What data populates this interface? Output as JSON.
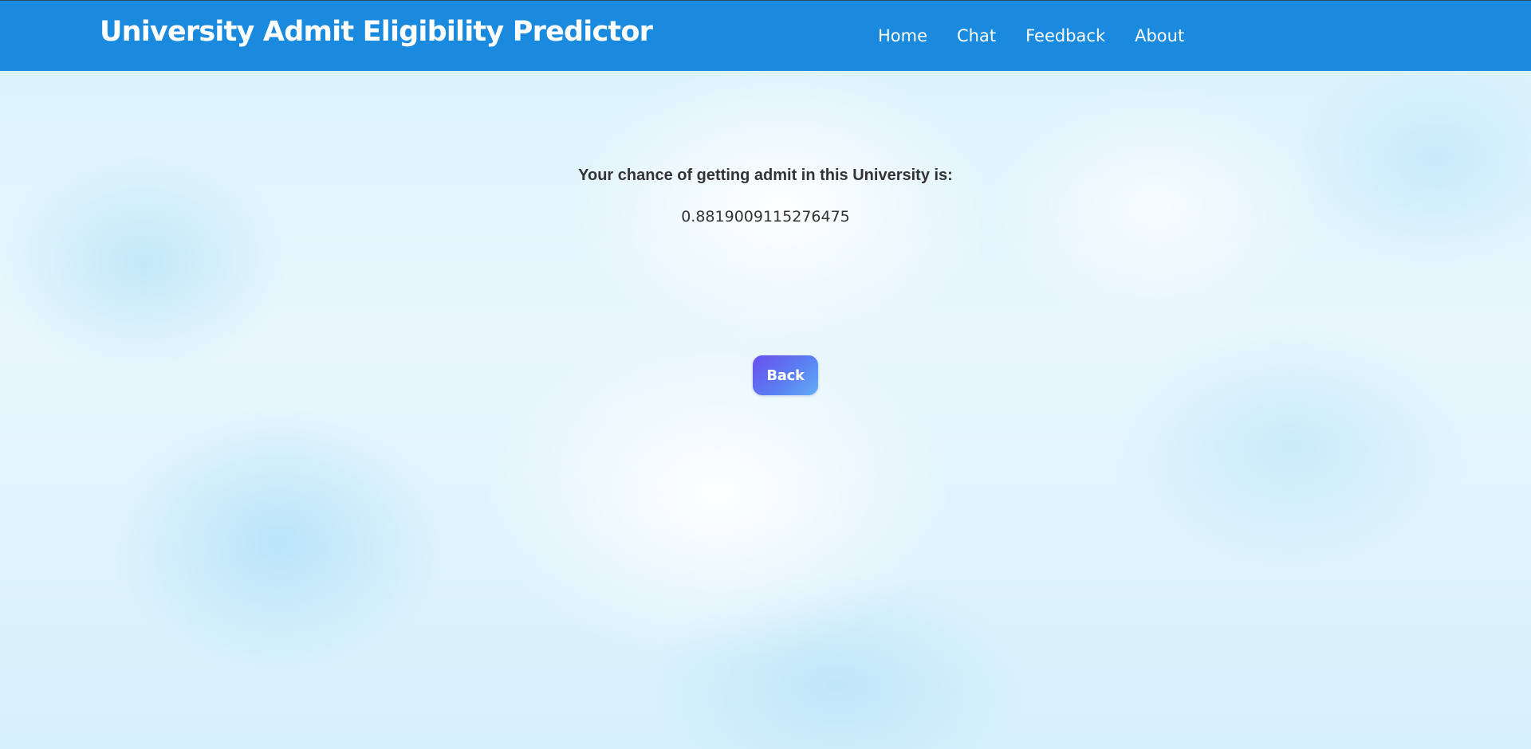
{
  "navbar": {
    "brand": "University Admit Eligibility Predictor",
    "links": [
      {
        "label": "Home"
      },
      {
        "label": "Chat"
      },
      {
        "label": "Feedback"
      },
      {
        "label": "About"
      }
    ]
  },
  "result": {
    "label": "Your chance of getting admit in this University is:",
    "value": "0.8819009115276475"
  },
  "actions": {
    "back_label": "Back"
  },
  "colors": {
    "navbar_bg": "#1a8ade",
    "button_gradient_start": "#6a4ff0",
    "button_gradient_end": "#62aff6",
    "text": "#333333"
  }
}
